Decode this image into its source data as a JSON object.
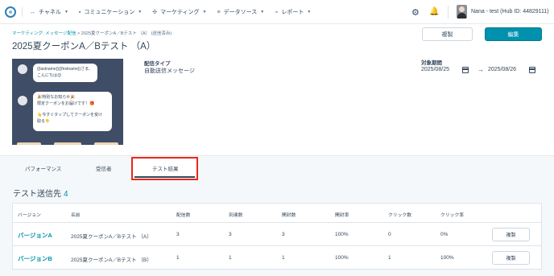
{
  "nav": {
    "items": [
      {
        "icon": "code-icon",
        "glyph": "↔",
        "label": "チャネル"
      },
      {
        "icon": "chat-icon",
        "glyph": "▪",
        "label": "コミュニケーション"
      },
      {
        "icon": "marketing-icon",
        "glyph": "✣",
        "label": "マーケティング"
      },
      {
        "icon": "database-icon",
        "glyph": "≡",
        "label": "データソース"
      },
      {
        "icon": "report-icon",
        "glyph": "⌁",
        "label": "レポート"
      }
    ],
    "user_label": "Nana - test (Hub ID: 44829111)"
  },
  "header": {
    "breadcrumb_link": "マーケティング: メッセージ配信",
    "breadcrumb_rest": " > 2025夏クーポンA／Bテスト （A） (送信済み)",
    "title": "2025夏クーポンA／Bテスト （A）",
    "duplicate_label": "複製",
    "edit_label": "編集"
  },
  "preview": {
    "bubble1": [
      "{{lastname}}{{firstname}}さま、",
      "こんにちは😊"
    ],
    "bubble2": [
      "🎉特別なお知らせ🎉",
      "限定クーポンをお届けです！🎁",
      "",
      "👆今すぐタップしてクーポンを受け",
      "取る👇"
    ]
  },
  "info": {
    "delivery_type_label": "配信タイプ",
    "delivery_type_value": "自動送信メッセージ",
    "period_label": "対象期間",
    "period_start": "2025/08/25",
    "period_end": "2025/08/26"
  },
  "tabs": [
    "パフォーマンス",
    "受信者",
    "テスト結果"
  ],
  "section": {
    "title": "テスト送信先",
    "count": "4"
  },
  "table": {
    "headers": [
      "バージョン",
      "名前",
      "配信数",
      "到達数",
      "開封数",
      "開封率",
      "クリック数",
      "クリック率"
    ],
    "rows": [
      {
        "version": "バージョンA",
        "name": "2025夏クーポンA／Bテスト （A）",
        "sent": "3",
        "delivered": "3",
        "opened": "3",
        "open_rate": "100%",
        "clicks": "0",
        "click_rate": "0%",
        "action": "複製"
      },
      {
        "version": "バージョンB",
        "name": "2025夏クーポンA／Bテスト （B）",
        "sent": "1",
        "delivered": "1",
        "opened": "1",
        "open_rate": "100%",
        "clicks": "1",
        "click_rate": "100%",
        "action": "複製"
      }
    ]
  },
  "colors": {
    "accent": "#0091ae",
    "highlight": "#e8291c",
    "text": "#33475b",
    "preview_bg": "#3f4d66"
  }
}
